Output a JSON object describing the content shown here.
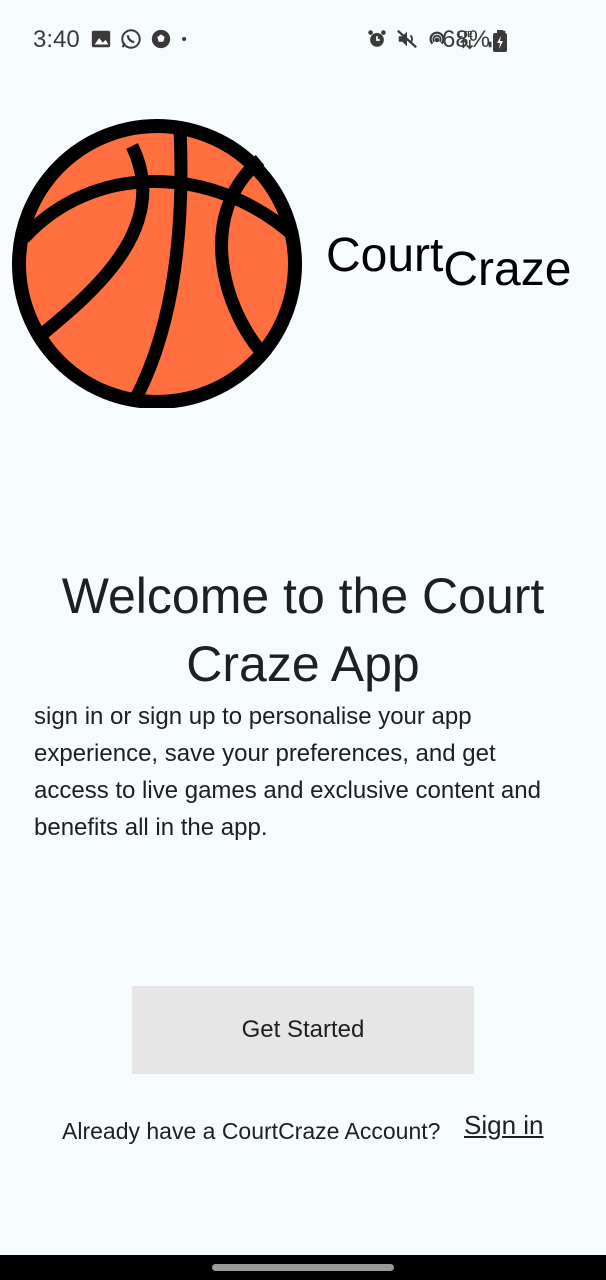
{
  "status_bar": {
    "time": "3:40",
    "left_icons": [
      "gallery-icon",
      "whatsapp-icon",
      "soccer-ball-icon",
      "dot-icon"
    ],
    "right_icons": [
      "alarm-icon",
      "mute-icon",
      "hotspot-icon",
      "lte-icon",
      "signal-icon"
    ],
    "battery": "68%"
  },
  "brand": {
    "part1": "Court",
    "part2": "Craze",
    "ball_color": "#ff6f3f"
  },
  "welcome": {
    "title": "Welcome to the Court Craze App",
    "body": "sign in or sign up to personalise your app experience, save your preferences, and get access to live games and exclusive content and benefits all in the app."
  },
  "actions": {
    "get_started": "Get Started",
    "account_prompt": "Already have a CourtCraze Account?",
    "sign_in": "Sign in"
  }
}
